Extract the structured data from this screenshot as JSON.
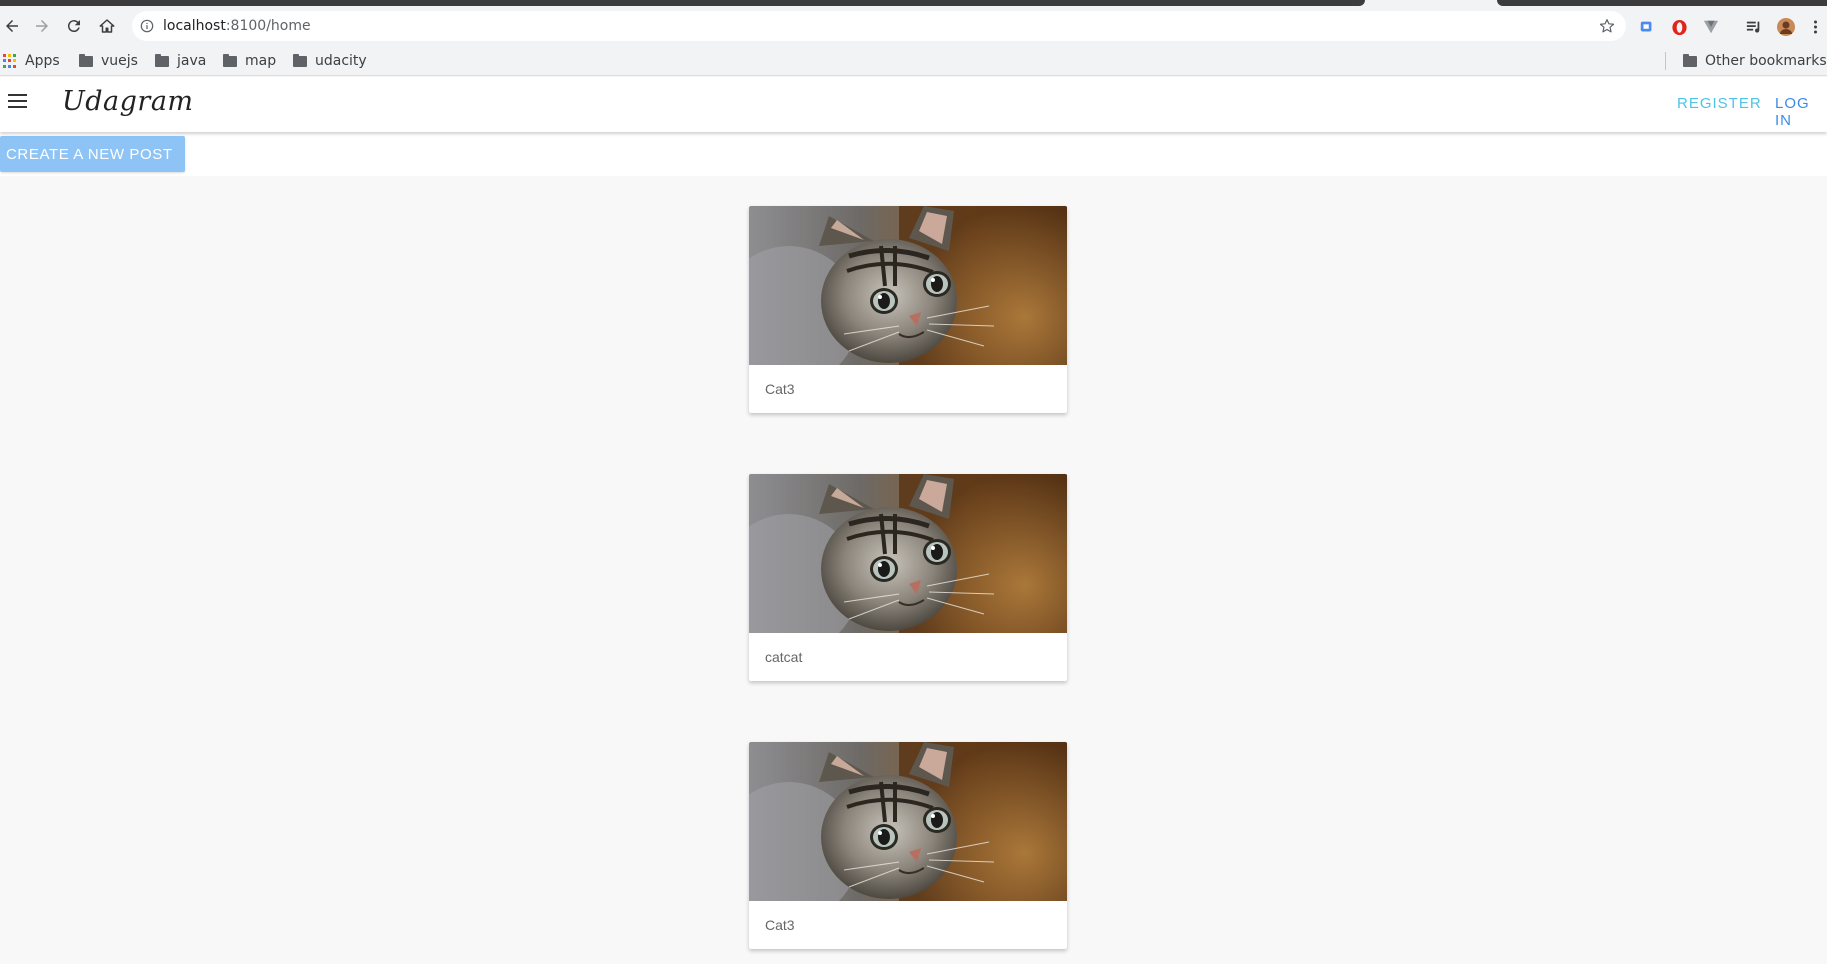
{
  "browser": {
    "url_host": "localhost",
    "url_rest": ":8100/home",
    "bookmarks": [
      {
        "label": "Apps",
        "icon": "apps-grid-icon"
      },
      {
        "label": "vuejs",
        "icon": "folder-icon"
      },
      {
        "label": "java",
        "icon": "folder-icon"
      },
      {
        "label": "map",
        "icon": "folder-icon"
      },
      {
        "label": "udacity",
        "icon": "folder-icon"
      }
    ],
    "other_bookmarks": "Other bookmarks"
  },
  "app": {
    "brand": "Udagram",
    "nav": {
      "register": "REGISTER",
      "login": "LOG IN"
    },
    "create_post": "CREATE A NEW POST",
    "posts": [
      {
        "caption": "Cat3",
        "image": "kitten-photo"
      },
      {
        "caption": "catcat",
        "image": "kitten-photo"
      },
      {
        "caption": "Cat3",
        "image": "kitten-photo"
      }
    ]
  },
  "colors": {
    "accent_register": "#4fc3e6",
    "accent_login": "#3d8ae6",
    "button_bg": "#8ec4f5",
    "page_bg": "#f8f8f8"
  }
}
